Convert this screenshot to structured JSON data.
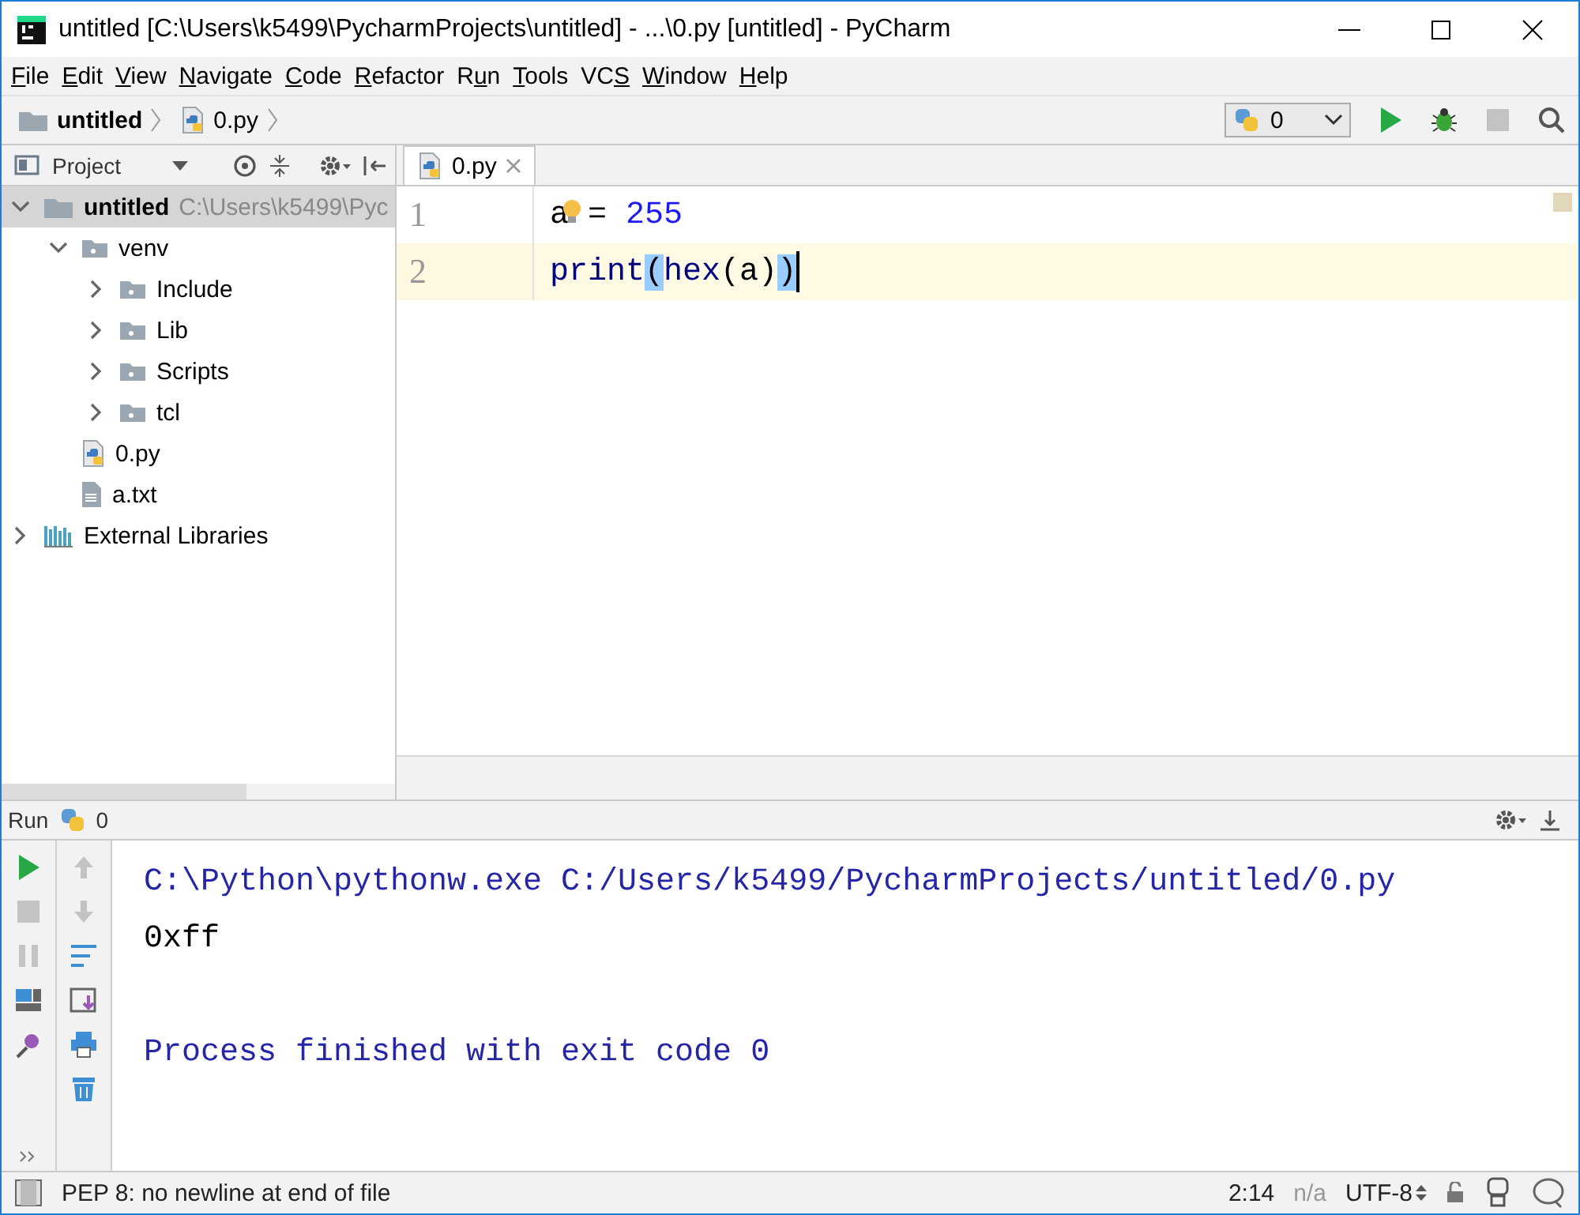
{
  "window": {
    "title": "untitled [C:\\Users\\k5499\\PycharmProjects\\untitled] - ...\\0.py [untitled] - PyCharm"
  },
  "menu": [
    {
      "key": "F",
      "post": "ile"
    },
    {
      "key": "E",
      "post": "dit"
    },
    {
      "key": "V",
      "post": "iew"
    },
    {
      "key": "N",
      "post": "avigate"
    },
    {
      "key": "C",
      "post": "ode"
    },
    {
      "key": "R",
      "post": "efactor"
    },
    {
      "pre": "R",
      "key": "u",
      "post": "n"
    },
    {
      "key": "T",
      "post": "ools"
    },
    {
      "pre": "VC",
      "key": "S"
    },
    {
      "key": "W",
      "post": "indow"
    },
    {
      "key": "H",
      "post": "elp"
    }
  ],
  "breadcrumbs": [
    {
      "label": "untitled",
      "kind": "folder"
    },
    {
      "label": "0.py",
      "kind": "python"
    }
  ],
  "run_config": {
    "value": "0"
  },
  "project_panel": {
    "title": "Project",
    "tree": [
      {
        "label": "untitled",
        "path": "C:\\Users\\k5499\\Pyc",
        "kind": "project",
        "expanded": true,
        "selected": true,
        "children": [
          {
            "label": "venv",
            "kind": "folder",
            "expanded": true,
            "selected": false,
            "children": [
              {
                "label": "Include",
                "kind": "folder",
                "expanded": false,
                "selected": false
              },
              {
                "label": "Lib",
                "kind": "folder",
                "expanded": false,
                "selected": false
              },
              {
                "label": "Scripts",
                "kind": "folder",
                "expanded": false,
                "selected": false
              },
              {
                "label": "tcl",
                "kind": "folder",
                "expanded": false,
                "selected": false
              }
            ]
          },
          {
            "label": "0.py",
            "kind": "python",
            "selected": false
          },
          {
            "label": "a.txt",
            "kind": "text",
            "selected": false
          }
        ]
      },
      {
        "label": "External Libraries",
        "kind": "library",
        "expanded": false,
        "selected": false
      }
    ]
  },
  "editor": {
    "tabs": [
      {
        "label": "0.py",
        "selected": true
      }
    ],
    "lines": [
      {
        "number": "1",
        "current": false,
        "bulb": true,
        "tokens": [
          {
            "text": "a",
            "kind": "plain",
            "matched": false
          },
          {
            "text": " = ",
            "kind": "plain",
            "matched": false
          },
          {
            "text": "255",
            "kind": "number",
            "matched": false
          }
        ]
      },
      {
        "number": "2",
        "current": true,
        "bulb": false,
        "tokens": [
          {
            "text": "print",
            "kind": "builtin",
            "matched": false
          },
          {
            "text": "(",
            "kind": "brace",
            "matched": true
          },
          {
            "text": "hex",
            "kind": "builtin",
            "matched": false
          },
          {
            "text": "(a)",
            "kind": "plain",
            "matched": false
          },
          {
            "text": ")",
            "kind": "brace",
            "matched": true
          }
        ]
      }
    ]
  },
  "run_panel": {
    "title": "Run",
    "config": "0",
    "console_blocks": [
      {
        "lines": [
          {
            "text": "C:\\Python\\pythonw.exe C:/Users/k5499/PycharmProjects/untitled/0.py",
            "kind": "system"
          },
          {
            "text": "0xff",
            "kind": "output"
          }
        ]
      },
      {
        "lines": [
          {
            "text": "Process finished with exit code 0",
            "kind": "system"
          }
        ]
      }
    ]
  },
  "status_bar": {
    "message": "PEP 8: no newline at end of file",
    "position": "2:14",
    "line_separator": "n/a",
    "encoding": "UTF-8"
  }
}
